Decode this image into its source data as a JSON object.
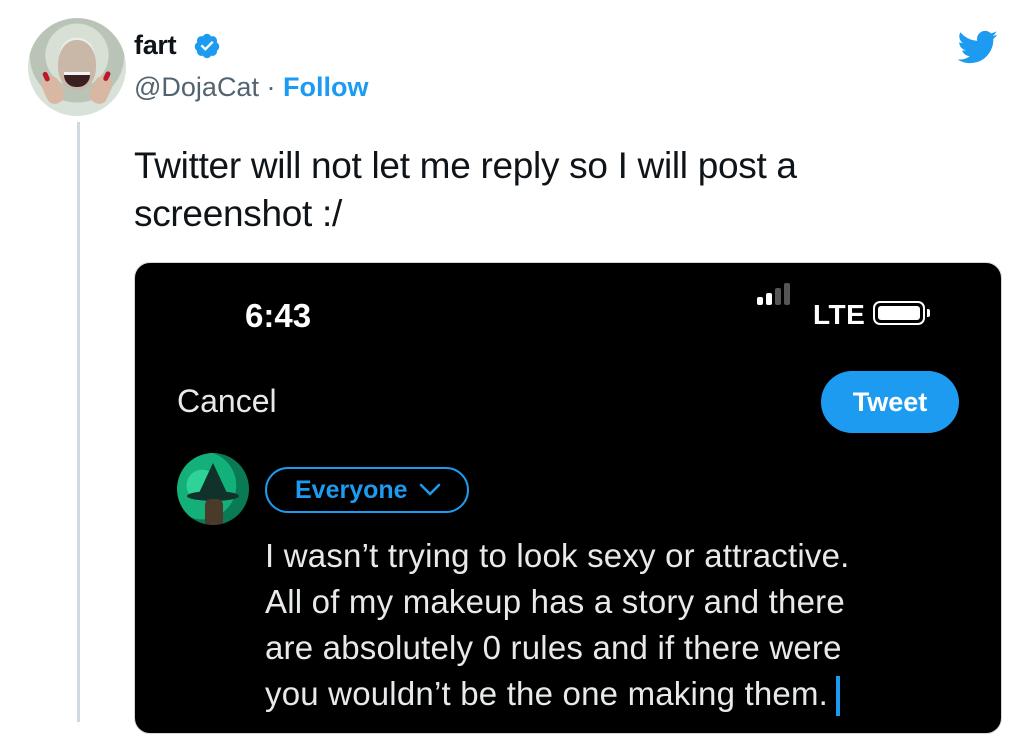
{
  "author": {
    "display_name": "fart",
    "handle": "@DojaCat",
    "separator": "·",
    "follow_label": "Follow"
  },
  "tweet": {
    "text": "Twitter will not let me reply so I will post a screenshot :/"
  },
  "screenshot": {
    "status_bar": {
      "time": "6:43",
      "network": "LTE"
    },
    "compose": {
      "cancel_label": "Cancel",
      "tweet_label": "Tweet",
      "audience_label": "Everyone",
      "text_lines": [
        "I wasn’t trying to look sexy or attractive.",
        "All of my makeup has a story and there",
        "are absolutely 0 rules and if there were",
        "you wouldn’t be the one making them."
      ]
    }
  },
  "colors": {
    "accent": "#1d9bf0",
    "secondary_text": "#536471",
    "media_background": "#000000"
  },
  "icons": {
    "verified": "verified-badge-icon",
    "bird": "twitter-bird-icon",
    "chevron": "chevron-down-icon"
  }
}
